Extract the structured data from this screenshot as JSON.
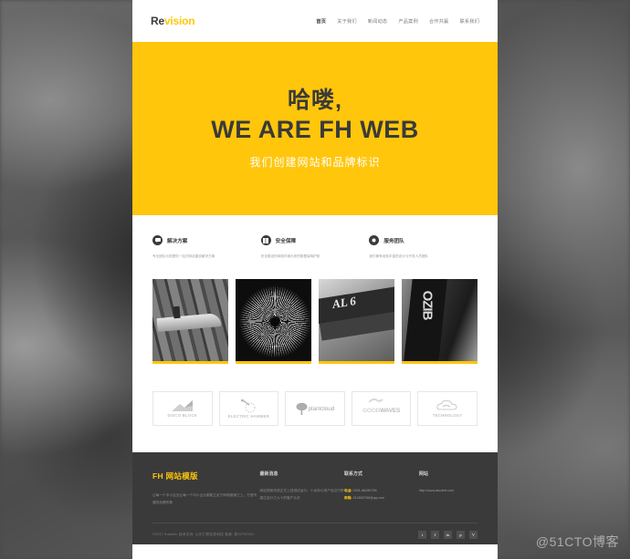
{
  "site": {
    "watermark": "@51CTO博客",
    "accent": "#FFC60B",
    "dark": "#3a3a3a"
  },
  "header": {
    "logo_part1": "Re",
    "logo_part2": "vision",
    "nav": [
      {
        "label": "首页",
        "active": true
      },
      {
        "label": "关于我们",
        "active": false
      },
      {
        "label": "新闻动态",
        "active": false
      },
      {
        "label": "产品案例",
        "active": false
      },
      {
        "label": "合作共赢",
        "active": false
      },
      {
        "label": "联系我们",
        "active": false
      }
    ]
  },
  "hero": {
    "greeting": "哈喽,",
    "headline": "WE ARE FH WEB",
    "subtitle": "我们创建网站和品牌标识"
  },
  "features": [
    {
      "icon": "chat-icon",
      "title": "解决方案",
      "desc": "专业团队为您提供一站式网站建设解决方案"
    },
    {
      "icon": "book-icon",
      "title": "安全保障",
      "desc": "安全稳定的网络环境为您的数据保驾护航"
    },
    {
      "icon": "play-icon",
      "title": "服务团队",
      "desc": "我们拥有经验丰富的设计与开发人员团队"
    }
  ],
  "gallery": [
    {
      "caption": "ship-model-photo"
    },
    {
      "caption": "dandelion-macro-photo"
    },
    {
      "caption": "street-sign-photo"
    },
    {
      "caption": "guitar-headstock-photo"
    }
  ],
  "clients": [
    {
      "name": "DISCO BLOCK",
      "icon": "arrow-block-icon"
    },
    {
      "name": "ELECTRIC HAMMER",
      "icon": "bulb-icon"
    },
    {
      "name": "plantcloud",
      "icon": "tree-icon"
    },
    {
      "name": "GOOD WAVES",
      "icon": "wave-icon"
    },
    {
      "name": "TECHNOLOGY",
      "icon": "cloud-icon"
    }
  ],
  "footer": {
    "brand": "FH 网站模版",
    "brand_desc": "让每一个中小企业让每一个中小企业都能立足于网络营销之上，打造专属的品牌形象",
    "col2_head": "最新消息",
    "col2_text": "网站改版完成正式上线测试运行，十余年以来产品交付率高达百分之九十的客户认可",
    "col3_head": "联系方式",
    "col3_line1_key": "电话:",
    "col3_line1_val": "0531-88289798",
    "col3_line2_key": "邮箱:",
    "col3_line2_val": "312663766@qq.com",
    "col4_head": "网站",
    "col4_url": "http://www.abcdefr.com",
    "copyright": "©2017 fhadmin   技术支持: 山东汇联信息科技   备案: 鲁ICP00001",
    "socials": [
      {
        "name": "twitter-icon",
        "glyph": "t"
      },
      {
        "name": "facebook-icon",
        "glyph": "f"
      },
      {
        "name": "linkedin-icon",
        "glyph": "in"
      },
      {
        "name": "pinterest-icon",
        "glyph": "p"
      },
      {
        "name": "vimeo-icon",
        "glyph": "V"
      }
    ]
  }
}
